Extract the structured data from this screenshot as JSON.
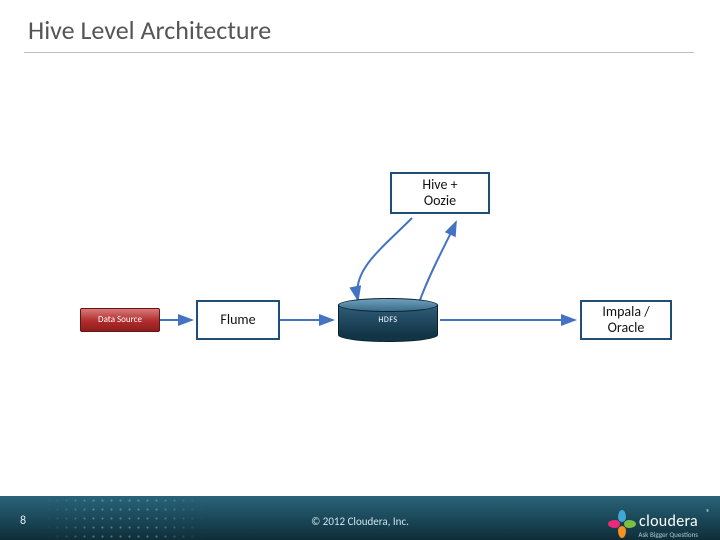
{
  "title": "Hive Level Architecture",
  "nodes": {
    "hive_oozie": "Hive +\nOozie",
    "data_source": "Data Source",
    "flume": "Flume",
    "hdfs": "HDFS",
    "impala_oracle": "Impala /\nOracle"
  },
  "footer": {
    "page": "8",
    "copyright": "© 2012 Cloudera, Inc.",
    "brand": "cloudera",
    "tagline": "Ask Bigger Questions"
  },
  "colors": {
    "box_border": "#1f4e79",
    "hdfs_fill": "#1f4e63",
    "data_source_fill": "#a52a2a",
    "arrow": "#4473c4",
    "petals": [
      "#3fa6d9",
      "#7ac143",
      "#f6921e",
      "#ec297b"
    ]
  }
}
